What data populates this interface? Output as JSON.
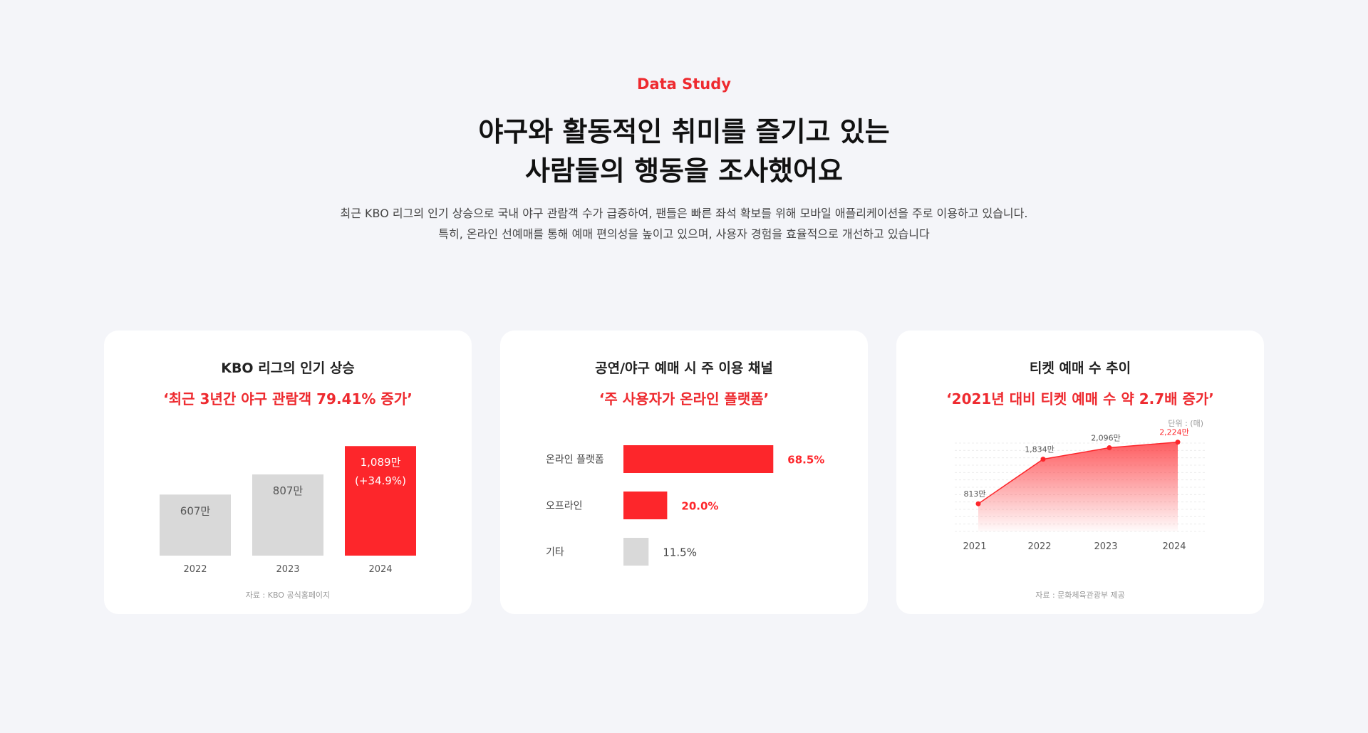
{
  "header": {
    "eyebrow": "Data Study",
    "title_line1": "야구와 활동적인 취미를 즐기고 있는",
    "title_line2": "사람들의 행동을 조사했어요",
    "desc_line1": "최근 KBO 리그의 인기 상승으로 국내 야구 관람객 수가 급증하여, 팬들은 빠른 좌석 확보를 위해 모바일 애플리케이션을 주로 이용하고 있습니다.",
    "desc_line2": "특히, 온라인 선예매를 통해 예매 편의성을 높이고 있으며, 사용자 경험을 효율적으로 개선하고 있습니다"
  },
  "colors": {
    "accent": "#fd262b",
    "gray": "#d9d9d9",
    "background": "#f4f5f9"
  },
  "cards": [
    {
      "title": "KBO 리그의 인기 상승",
      "subtitle": "‘최근 3년간 야구 관람객 79.41% 증가’",
      "source": "자료 : KBO 공식홈페이지"
    },
    {
      "title": "공연/야구 예매 시 주 이용 채널",
      "subtitle": "‘주 사용자가 온라인 플랫폼’",
      "source": ""
    },
    {
      "title": "티켓 예매 수 추이",
      "subtitle": "‘2021년 대비 티켓 예매 수 약 2.7배 증가’",
      "source": "자료 : 문화체육관광부 제공",
      "unit": "단위 : (매)"
    }
  ],
  "chart_data": [
    {
      "type": "bar",
      "categories": [
        "2022",
        "2023",
        "2024"
      ],
      "values": [
        607,
        807,
        1089
      ],
      "value_labels": [
        "607만",
        "807만",
        "1,089만"
      ],
      "extra_labels": [
        "",
        "",
        "(+34.9%)"
      ],
      "highlight_index": 2
    },
    {
      "type": "bar",
      "orientation": "horizontal",
      "categories": [
        "온라인 플랫폼",
        "오프라인",
        "기타"
      ],
      "values": [
        68.5,
        20.0,
        11.5
      ],
      "value_labels": [
        "68.5%",
        "20.0%",
        "11.5%"
      ],
      "highlighted": [
        true,
        true,
        false
      ]
    },
    {
      "type": "area",
      "categories": [
        "2021",
        "2022",
        "2023",
        "2024"
      ],
      "values": [
        813,
        1834,
        2096,
        2224
      ],
      "value_labels": [
        "813만",
        "1,834만",
        "2,096만",
        "2,224만"
      ],
      "highlight_index": 3
    }
  ]
}
